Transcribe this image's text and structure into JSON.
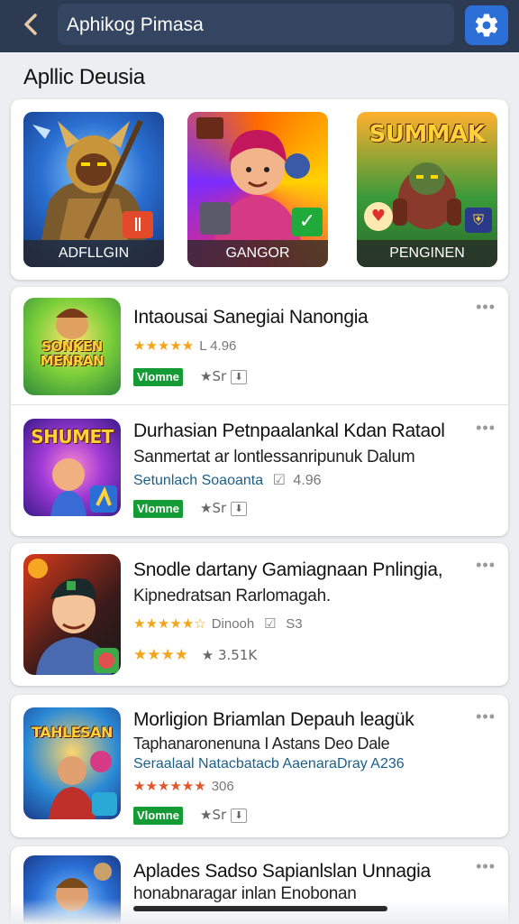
{
  "header": {
    "back_icon": "chevron-left-icon",
    "search_text": "Aphikog Pimasa",
    "settings_icon": "gear-icon",
    "colors": {
      "bar": "#2c3b52",
      "settings_button": "#2c6fd6"
    }
  },
  "section": {
    "title": "Apllic Deusia"
  },
  "featured": [
    {
      "label": "ADFLLGIN",
      "corner_icon": "sword-badge-icon"
    },
    {
      "label": "GANGOR",
      "corner_icon": "check-badge-icon"
    },
    {
      "label": "PENGINEN",
      "icon_text": "SUMMAK",
      "corner_icon": "shield-badge-icon"
    }
  ],
  "apps": [
    {
      "icon_text": "SONKEN MENRAN",
      "title": "Intaousai Sanegiai Nanongia",
      "rating_stars": "★★★★★",
      "rating_text": "L 4.96",
      "badge": "Vlomne",
      "downloads": "★Sr",
      "download_icon": "download-icon"
    },
    {
      "icon_text": "SHUMET",
      "title": "Durhasian Petnpaalankal Kdan Rataol",
      "subtitle": "Sanmertat ar lontlessanripunuk Dalum",
      "meta": "Setunlach Soaoanta",
      "meta_value": "4.96",
      "badge": "Vlomne",
      "downloads": "★Sr",
      "download_icon": "download-icon"
    },
    {
      "title": "Snodle dartany Gamiagnaan Pnlingia,",
      "subtitle": "Kipnedratsan Rarlomagah.",
      "rating_stars": "★★★★★☆",
      "rating_text": "Dinooh",
      "rating_value": "S3",
      "downloads_stars": "★★★★",
      "downloads": "★ 3.51K"
    },
    {
      "icon_text": "TAHLESAN",
      "title": "Morligion Briamlan Depauh leagük",
      "subtitle": "Taphanaronenuna I Astans Deo Dale",
      "meta": "Seraalaal Natacbatacb AaenaraDray A236",
      "rating_stars": "★★★★★★",
      "rating_text": "306",
      "badge": "Vlomne",
      "downloads": "★Sr",
      "download_icon": "download-icon"
    },
    {
      "title": "Aplades Sadso Sapianlslan Unnagia",
      "subtitle": "honabnaragar inlan Enobonan"
    }
  ],
  "more_icon": "more-dots-icon"
}
